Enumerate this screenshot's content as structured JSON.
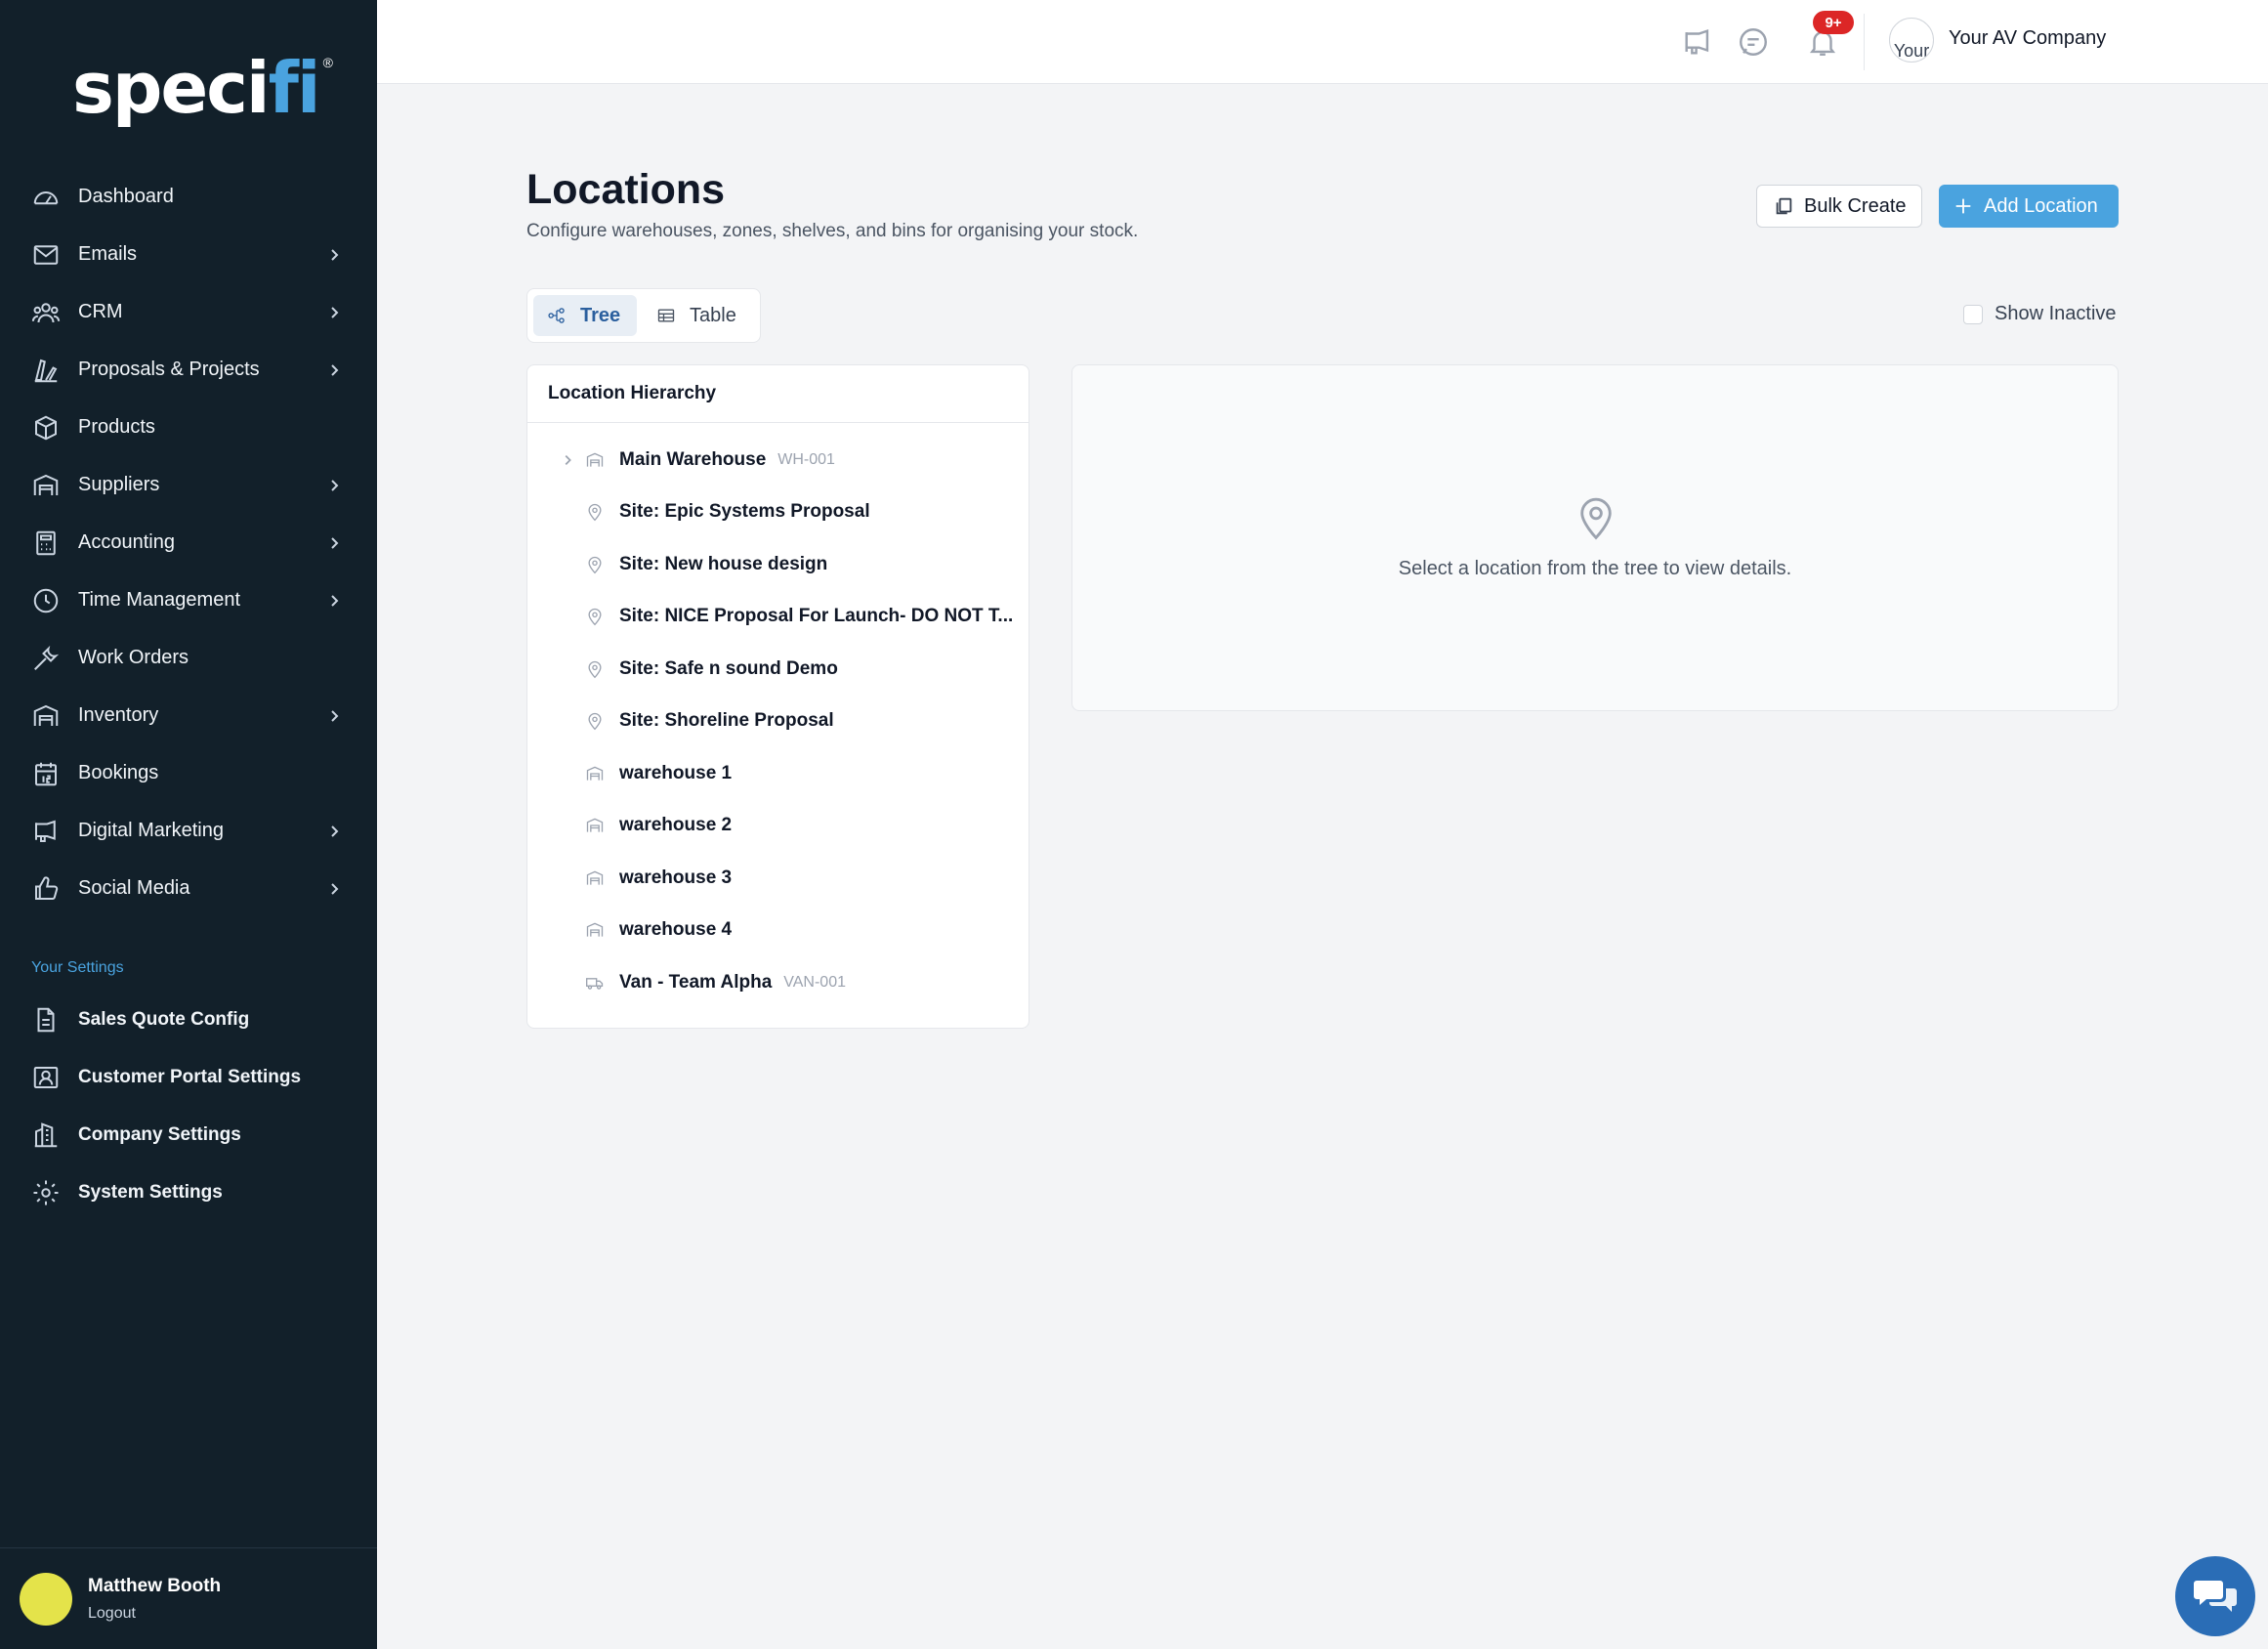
{
  "brand": {
    "logo_main": "speci",
    "logo_accent": "fi",
    "logo_reg": "®"
  },
  "sidebar": {
    "items": [
      {
        "label": "Dashboard",
        "icon": "gauge-icon",
        "has_submenu": false
      },
      {
        "label": "Emails",
        "icon": "envelope-icon",
        "has_submenu": true
      },
      {
        "label": "CRM",
        "icon": "users-icon",
        "has_submenu": true
      },
      {
        "label": "Proposals & Projects",
        "icon": "drafting-icon",
        "has_submenu": true
      },
      {
        "label": "Products",
        "icon": "box-icon",
        "has_submenu": false
      },
      {
        "label": "Suppliers",
        "icon": "warehouse-icon",
        "has_submenu": true
      },
      {
        "label": "Accounting",
        "icon": "calculator-icon",
        "has_submenu": true
      },
      {
        "label": "Time Management",
        "icon": "clock-icon",
        "has_submenu": true
      },
      {
        "label": "Work Orders",
        "icon": "wrench-icon",
        "has_submenu": false
      },
      {
        "label": "Inventory",
        "icon": "warehouse-icon",
        "has_submenu": true
      },
      {
        "label": "Bookings",
        "icon": "calendar-icon",
        "has_submenu": false
      },
      {
        "label": "Digital Marketing",
        "icon": "megaphone-icon",
        "has_submenu": true
      },
      {
        "label": "Social Media",
        "icon": "thumbs-up-icon",
        "has_submenu": true
      }
    ],
    "settings_heading": "Your Settings",
    "settings_items": [
      {
        "label": "Sales Quote Config",
        "icon": "document-icon"
      },
      {
        "label": "Customer Portal Settings",
        "icon": "portrait-icon"
      },
      {
        "label": "Company Settings",
        "icon": "building-icon"
      },
      {
        "label": "System Settings",
        "icon": "gear-icon"
      }
    ],
    "user": {
      "name": "Matthew Booth",
      "logout": "Logout"
    }
  },
  "topbar": {
    "notifications_badge": "9+",
    "company_avatar_alt": "Your",
    "company_name": "Your AV Company"
  },
  "page": {
    "title": "Locations",
    "subtitle": "Configure warehouses, zones, shelves, and bins for organising your stock.",
    "bulk_create": "Bulk Create",
    "add_location": "Add Location",
    "view_tree": "Tree",
    "view_table": "Table",
    "show_inactive": "Show Inactive"
  },
  "tree": {
    "heading": "Location Hierarchy",
    "rows": [
      {
        "name": "Main Warehouse",
        "code": "WH-001",
        "icon": "warehouse-icon",
        "expandable": true
      },
      {
        "name": "Site: Epic Systems Proposal",
        "code": "",
        "icon": "map-pin-icon",
        "expandable": false
      },
      {
        "name": "Site: New house design",
        "code": "",
        "icon": "map-pin-icon",
        "expandable": false
      },
      {
        "name": "Site: NICE Proposal For Launch- DO NOT T...",
        "code": "",
        "icon": "map-pin-icon",
        "expandable": false
      },
      {
        "name": "Site: Safe n sound Demo",
        "code": "",
        "icon": "map-pin-icon",
        "expandable": false
      },
      {
        "name": "Site: Shoreline Proposal",
        "code": "",
        "icon": "map-pin-icon",
        "expandable": false
      },
      {
        "name": "warehouse 1",
        "code": "",
        "icon": "warehouse-icon",
        "expandable": false
      },
      {
        "name": "warehouse 2",
        "code": "",
        "icon": "warehouse-icon",
        "expandable": false
      },
      {
        "name": "warehouse 3",
        "code": "",
        "icon": "warehouse-icon",
        "expandable": false
      },
      {
        "name": "warehouse 4",
        "code": "",
        "icon": "warehouse-icon",
        "expandable": false
      },
      {
        "name": "Van - Team Alpha",
        "code": "VAN-001",
        "icon": "truck-icon",
        "expandable": false
      }
    ]
  },
  "detail": {
    "empty_message": "Select a location from the tree to view details."
  },
  "colors": {
    "sidebar_bg": "#12202a",
    "accent": "#4aa3df",
    "badge": "#dc2626",
    "chat_button": "#2a6db6"
  }
}
